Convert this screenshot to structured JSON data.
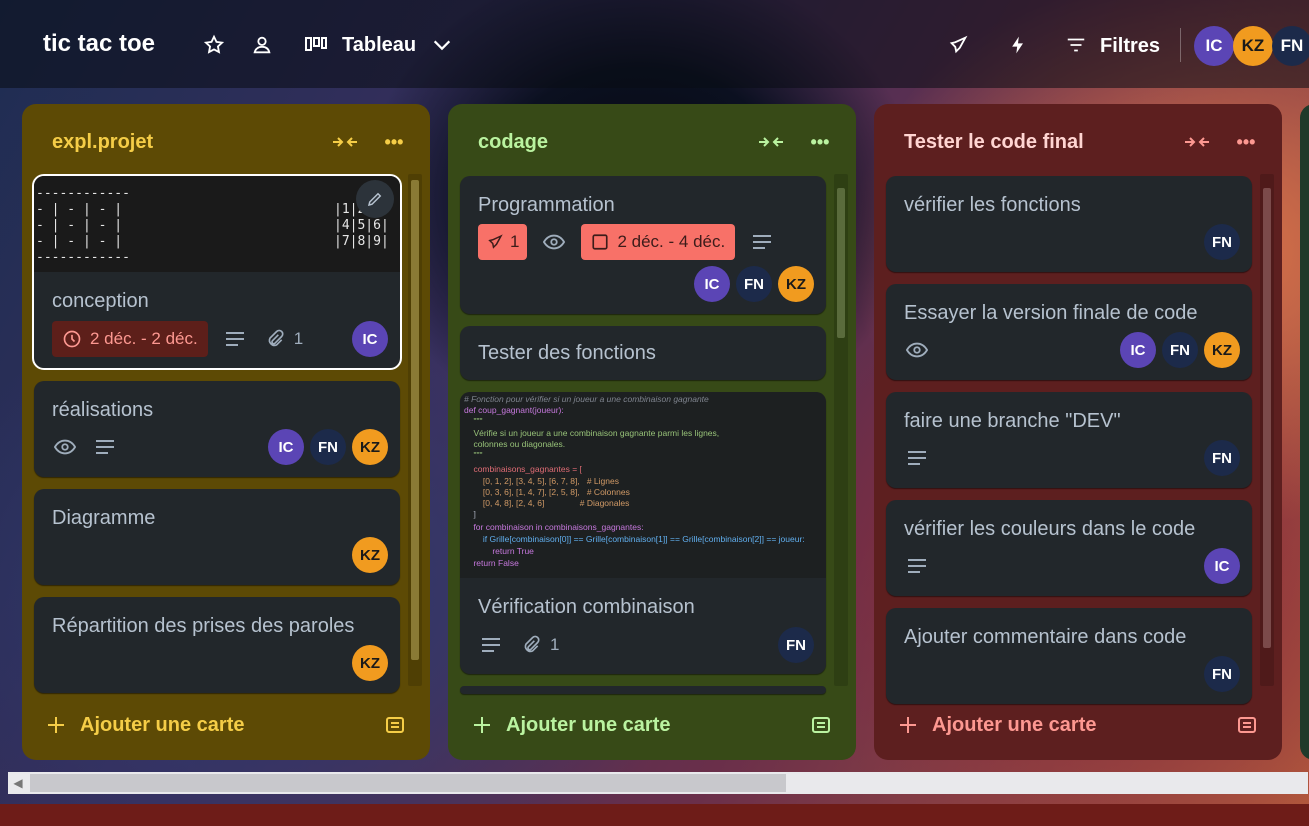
{
  "header": {
    "board_title": "tic tac toe",
    "view_label": "Tableau",
    "filters_label": "Filtres",
    "members": [
      "IC",
      "KZ",
      "FN"
    ]
  },
  "lists": [
    {
      "title": "expl.projet",
      "add_label": "Ajouter une carte",
      "cards": [
        {
          "title": "conception",
          "cover_ascii_left": "------------\n- | - | - |\n- | - | - |\n- | - | - |\n------------",
          "cover_ascii_right": "|1|2| \n|4|5|6|\n|7|8|9|",
          "due": "2 déc. - 2 déc.",
          "attachments": "1",
          "members": [
            "IC"
          ]
        },
        {
          "title": "réalisations",
          "members": [
            "IC",
            "FN",
            "KZ"
          ]
        },
        {
          "title": "Diagramme",
          "members": [
            "KZ"
          ]
        },
        {
          "title": "Répartition des prises des paroles",
          "members": [
            "KZ"
          ]
        }
      ]
    },
    {
      "title": "codage",
      "add_label": "Ajouter une carte",
      "cards": [
        {
          "title": "Programmation",
          "location_count": "1",
          "due": "2 déc. - 4 déc.",
          "members": [
            "IC",
            "FN",
            "KZ"
          ]
        },
        {
          "title": "Tester des fonctions"
        },
        {
          "title": "Vérification combinaison",
          "attachments": "1",
          "members": [
            "FN"
          ],
          "code_lines": [
            "# Fonction pour vérifier si un joueur a une combinaison gagnante",
            "def coup_gagnant(joueur):",
            "    \"\"\"",
            "    Vérifie si un joueur a une combinaison gagnante parmi les lignes,",
            "    colonnes ou diagonales.",
            "    \"\"\"",
            "    combinaisons_gagnantes = [",
            "        [0, 1, 2], [3, 4, 5], [6, 7, 8],   # Lignes",
            "        [0, 3, 6], [1, 4, 7], [2, 5, 8],   # Colonnes",
            "        [0, 4, 8], [2, 4, 6]               # Diagonales",
            "    ]",
            "    for combinaison in combinaisons_gagnantes:",
            "        if Grille[combinaison[0]] == Grille[combinaison[1]] == Grille[combinaison[2]] == joueur:",
            "            return True",
            "    return False"
          ]
        }
      ]
    },
    {
      "title": "Tester le code final",
      "add_label": "Ajouter une carte",
      "cards": [
        {
          "title": "vérifier les fonctions",
          "members": [
            "FN"
          ]
        },
        {
          "title": "Essayer la version finale de code",
          "members": [
            "IC",
            "FN",
            "KZ"
          ]
        },
        {
          "title": "faire une branche \"DEV\"",
          "members": [
            "FN"
          ]
        },
        {
          "title": "vérifier les couleurs dans le code",
          "members": [
            "IC"
          ]
        },
        {
          "title": "Ajouter commentaire dans code",
          "members": [
            "FN"
          ]
        }
      ]
    }
  ],
  "colors": {
    "yellow_list": "#5d4a05",
    "green_list": "#374a17",
    "red_list": "#5d1f1f",
    "card_bg": "#22272b",
    "member_ic": "#5b45b5",
    "member_fn": "#1c2a4a",
    "member_kz": "#f19b1f"
  }
}
